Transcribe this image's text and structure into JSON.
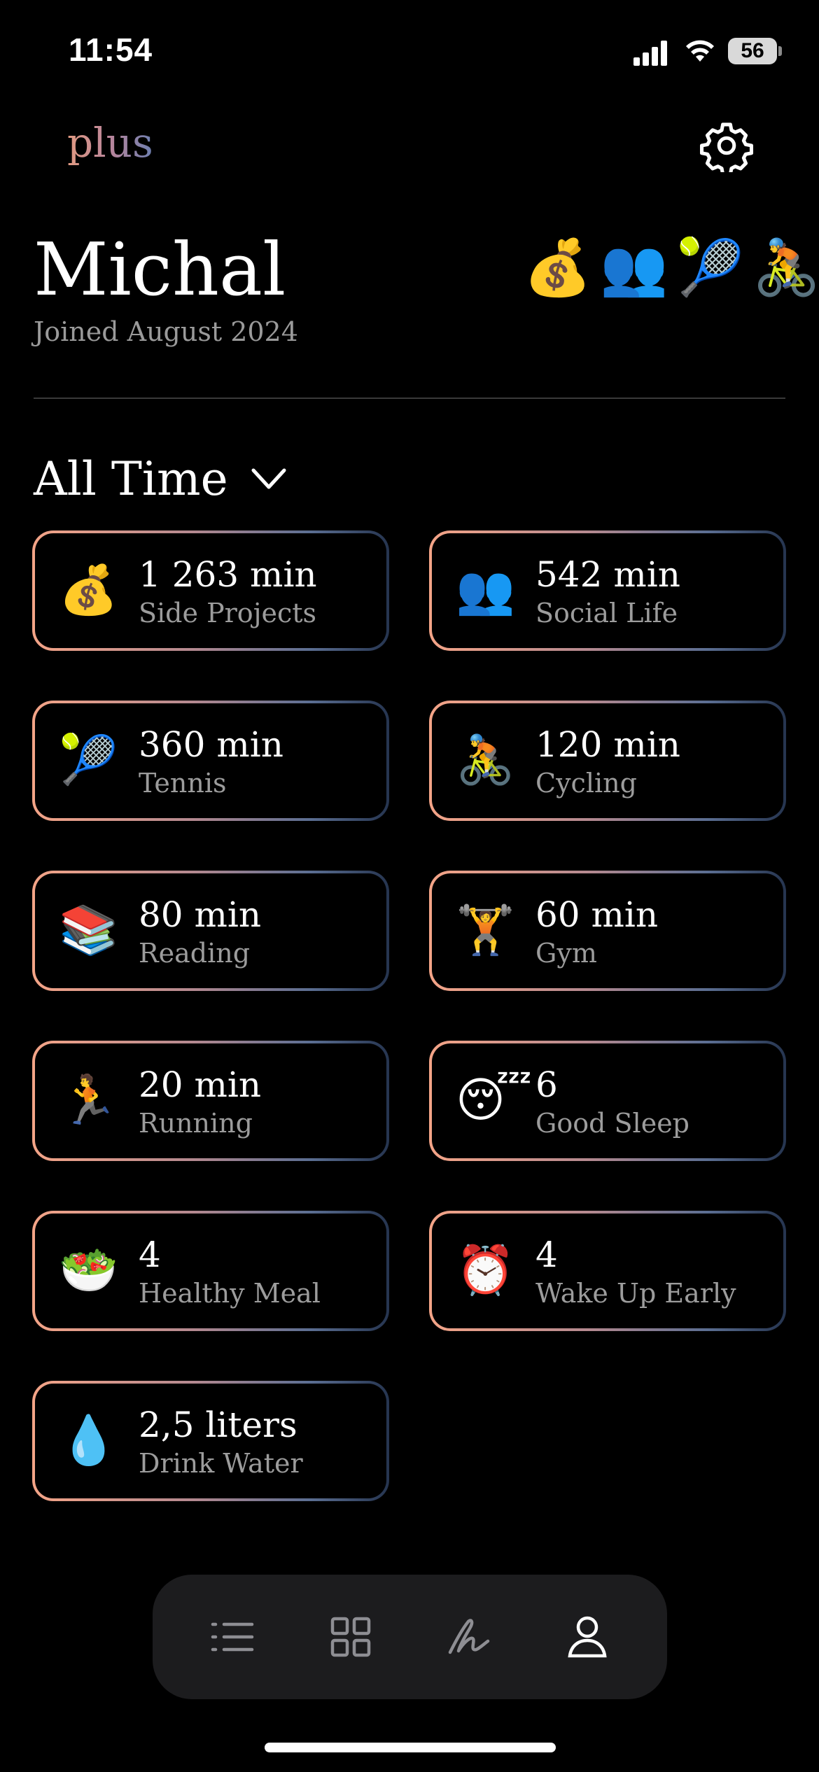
{
  "status_bar": {
    "time": "11:54",
    "battery_level": "56"
  },
  "header": {
    "logo_text": "plus",
    "settings_icon": "gear-icon"
  },
  "profile": {
    "name": "Michal",
    "joined": "Joined August 2024",
    "favorite_emojis": [
      "💰",
      "👥",
      "🎾",
      "🚴"
    ]
  },
  "filter": {
    "period": "All Time"
  },
  "stats": [
    {
      "icon": "💰",
      "value": "1 263 min",
      "label": "Side Projects"
    },
    {
      "icon": "👥",
      "value": "542 min",
      "label": "Social Life"
    },
    {
      "icon": "🎾",
      "value": "360 min",
      "label": "Tennis"
    },
    {
      "icon": "🚴",
      "value": "120 min",
      "label": "Cycling"
    },
    {
      "icon": "📚",
      "value": "80 min",
      "label": "Reading"
    },
    {
      "icon": "🏋️",
      "value": "60 min",
      "label": "Gym"
    },
    {
      "icon": "🏃",
      "value": "20 min",
      "label": "Running"
    },
    {
      "icon": "😴",
      "value": "6",
      "label": "Good Sleep"
    },
    {
      "icon": "🥗",
      "value": "4",
      "label": "Healthy Meal"
    },
    {
      "icon": "⏰",
      "value": "4",
      "label": "Wake Up Early"
    },
    {
      "icon": "💧",
      "value": "2,5 liters",
      "label": "Drink Water"
    }
  ],
  "tab_bar": {
    "tabs": [
      "list-icon",
      "grid-icon",
      "signature-icon",
      "profile-icon"
    ],
    "active": "profile-icon"
  },
  "colors": {
    "background": "#000000",
    "card_gradient_start": "#f4a487",
    "card_gradient_end": "#25344f",
    "secondary_text": "#9c9c9c",
    "tab_bar_bg": "#1c1c1e"
  }
}
